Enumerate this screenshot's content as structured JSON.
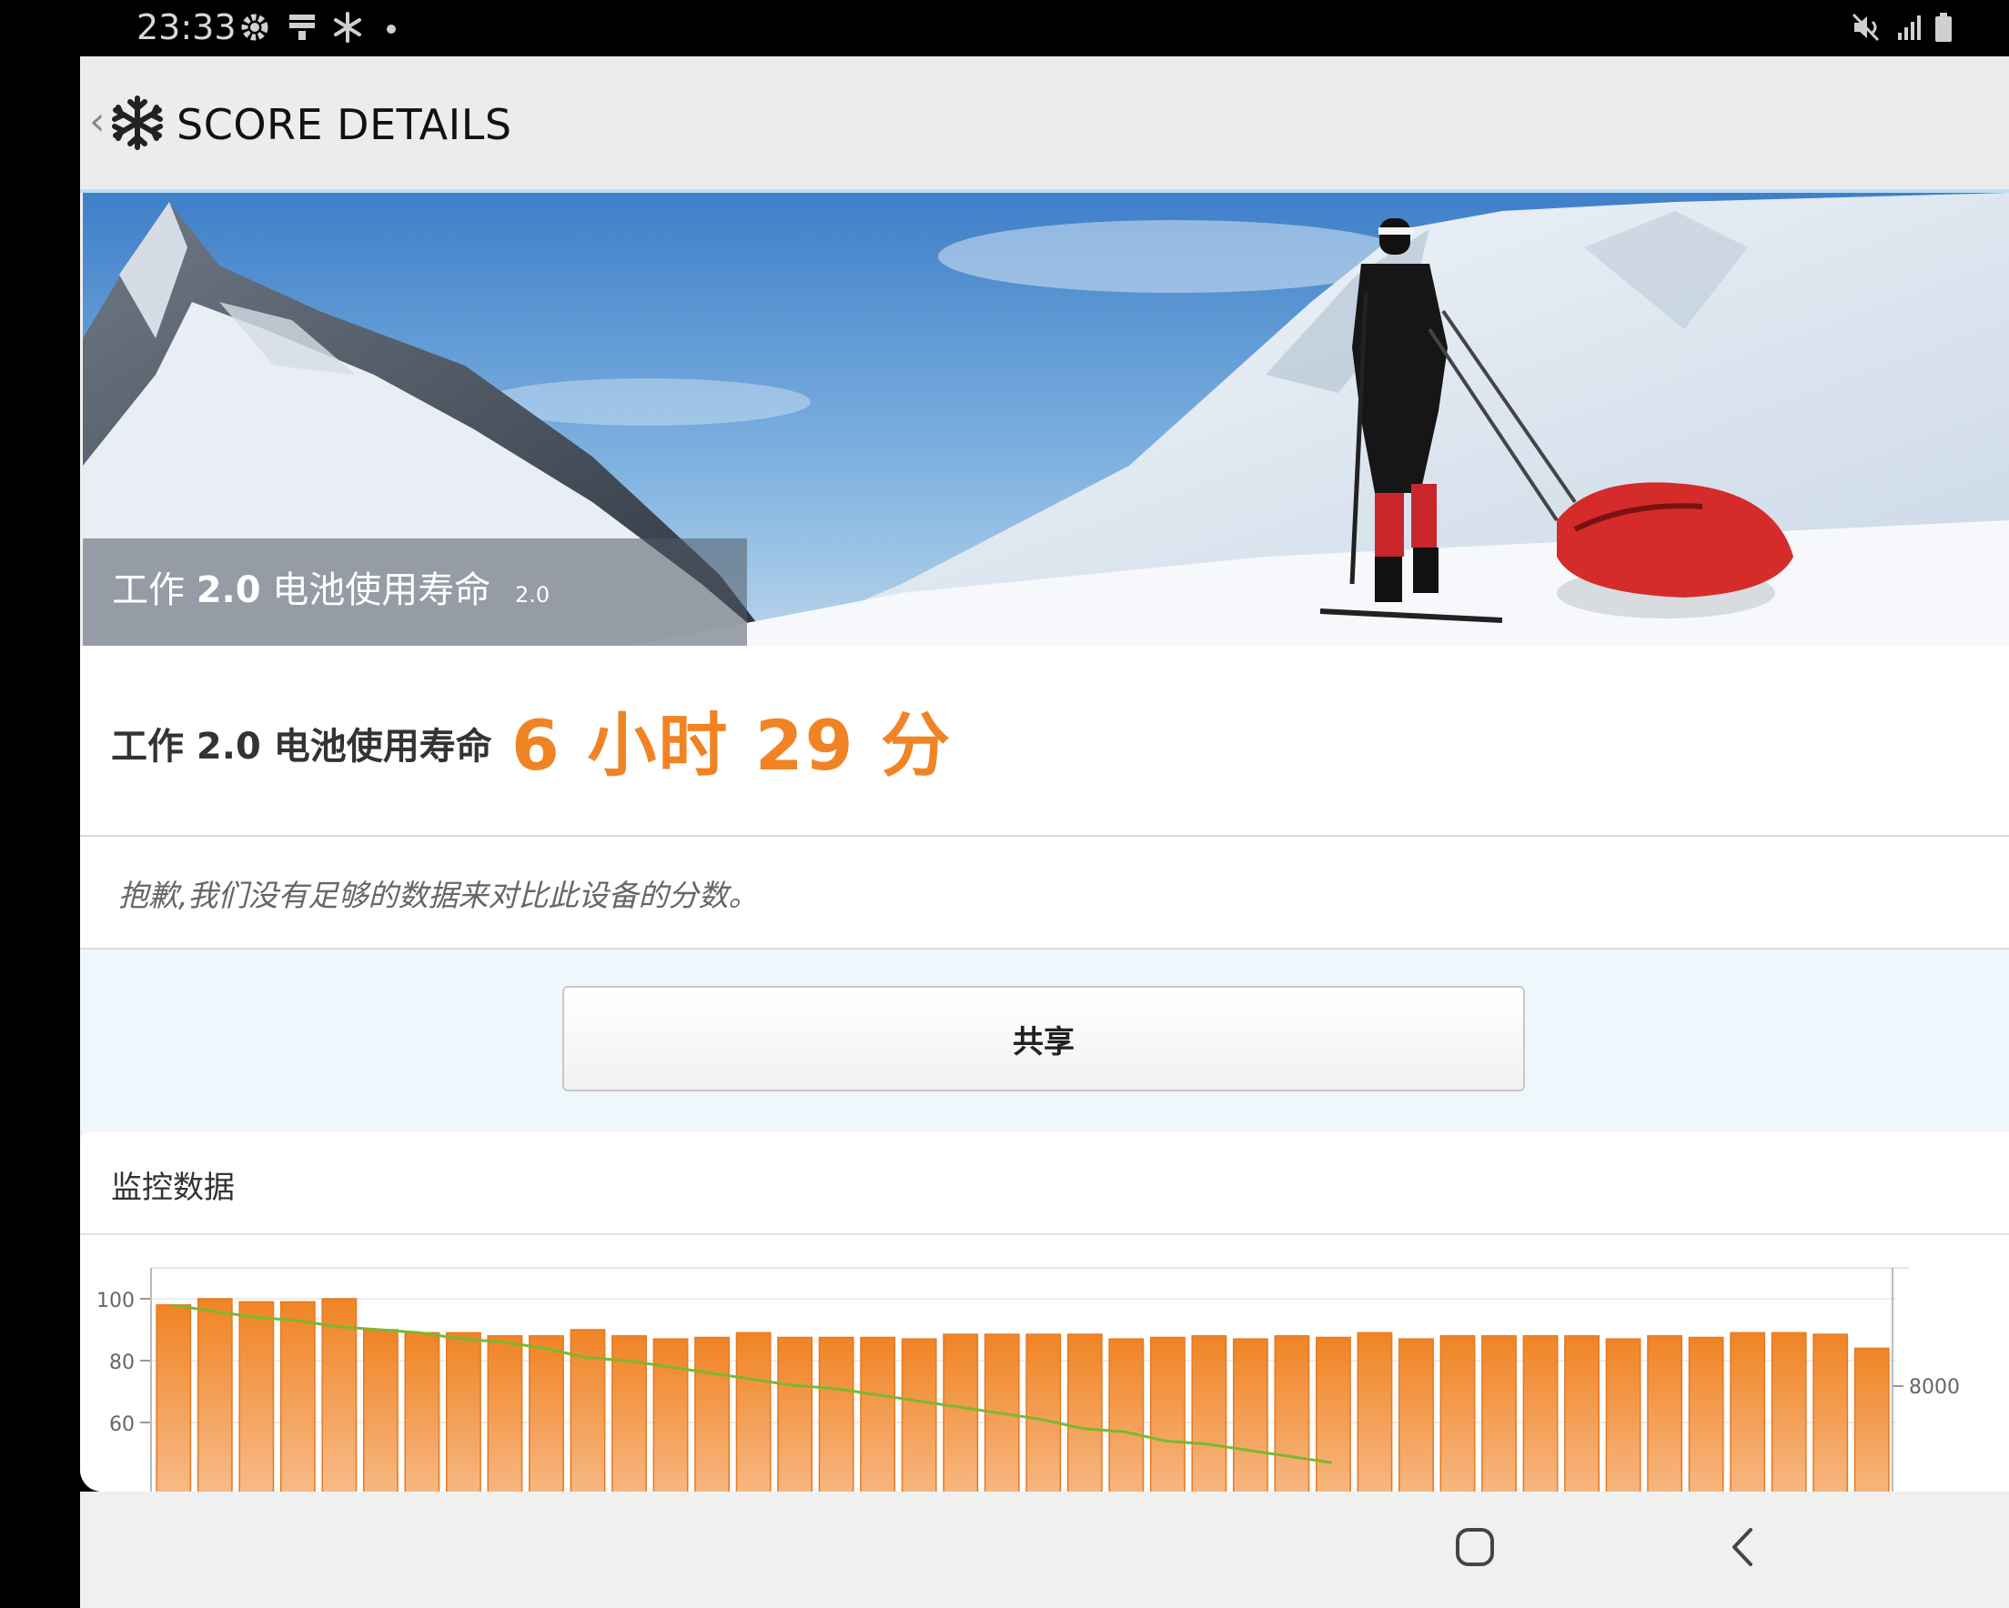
{
  "status_bar": {
    "time": "23:33",
    "left_icons": [
      "gear-icon",
      "storage-icon",
      "snowflake-icon",
      "dot-icon"
    ],
    "right_icons": [
      "mute-icon",
      "signal-icon",
      "battery-icon"
    ]
  },
  "header": {
    "back_glyph": "‹",
    "title": "SCORE DETAILS"
  },
  "hero": {
    "caption_prefix": "工作",
    "caption_bold": "2.0",
    "caption_suffix": "电池使用寿命",
    "caption_version": "2.0"
  },
  "score": {
    "label": "工作 2.0 电池使用寿命",
    "value": "6 小时 29 分"
  },
  "notice": {
    "text": "抱歉,我们没有足够的数据来对比此设备的分数。"
  },
  "share": {
    "label": "共享"
  },
  "monitor": {
    "title": "监控数据"
  },
  "chart_data": {
    "type": "bar",
    "bar_color": "#f08425",
    "line_color": "#7cb82f",
    "yticks_left": [
      100,
      80,
      60
    ],
    "yticks_right": [
      "8000"
    ],
    "ylim": [
      40,
      110
    ],
    "values": [
      98,
      100,
      99,
      99,
      100,
      90,
      89,
      89,
      88,
      88,
      90,
      88,
      87,
      87.5,
      89,
      87.5,
      87.5,
      87.5,
      87,
      88.5,
      88.5,
      88.5,
      88.5,
      87,
      87.5,
      88,
      87,
      88,
      87.5,
      89,
      87,
      88,
      88,
      88,
      88,
      87,
      88,
      87.5,
      89,
      89,
      88.5,
      84
    ],
    "line_values": [
      98,
      96,
      94,
      93,
      91,
      90,
      89,
      87,
      86,
      84,
      81,
      80,
      78,
      76,
      74,
      72,
      71,
      69,
      67,
      65,
      63,
      61,
      58,
      57,
      54,
      53,
      51,
      49,
      47
    ],
    "series": [
      {
        "type": "bar"
      },
      {
        "type": "line"
      }
    ]
  },
  "nav": {
    "buttons": [
      "home-button",
      "back-button"
    ]
  }
}
